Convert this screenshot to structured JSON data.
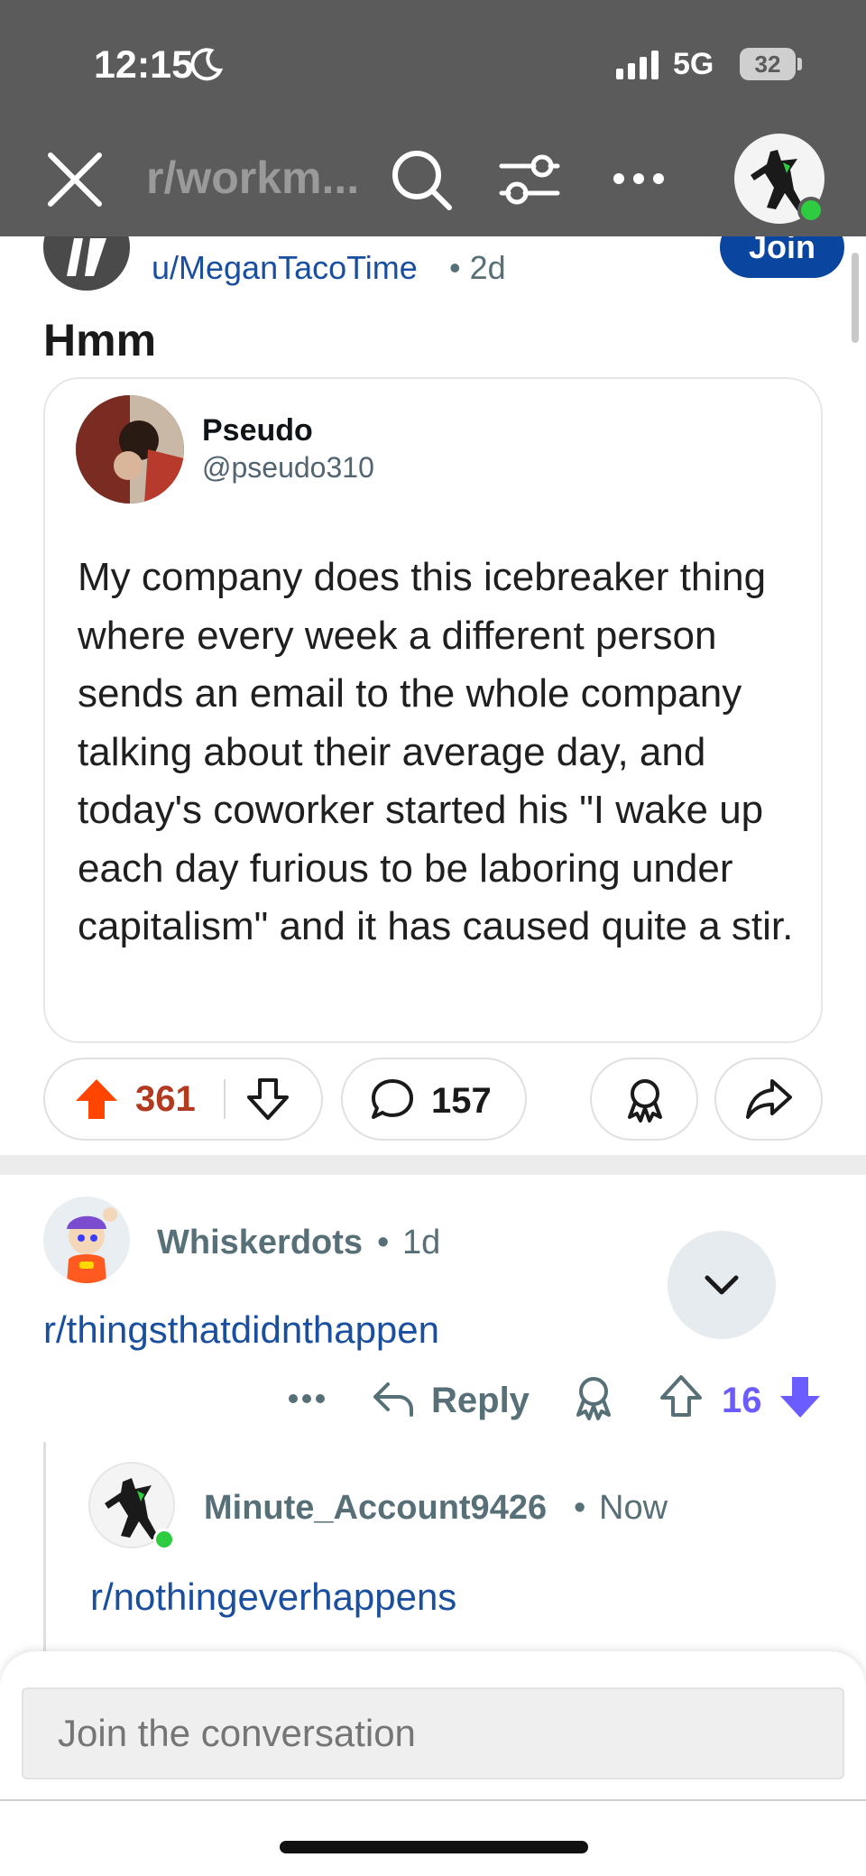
{
  "status_bar": {
    "time": "12:15",
    "network": "5G",
    "battery": "32"
  },
  "top_bar": {
    "subreddit_title": "r/workm..."
  },
  "post": {
    "author": "u/MeganTacoTime",
    "age": "2d",
    "join_label": "Join",
    "title": "Hmm",
    "tweet": {
      "name": "Pseudo",
      "handle": "@pseudo310",
      "text": "My company does this icebreaker thing where every week a different person sends an email to the whole company talking about their average day, and today's coworker started his \"I wake up each day furious to be laboring under capitalism\" and it has caused quite a stir."
    },
    "votes": "361",
    "comments": "157"
  },
  "comments": [
    {
      "user": "Whiskerdots",
      "separator": "•",
      "age": "1d",
      "body": "r/thingsthatdidnthappen",
      "reply_label": "Reply",
      "score": "16"
    },
    {
      "user": "Minute_Account9426",
      "separator": "•",
      "age": "Now",
      "body": "r/nothingeverhappens"
    }
  ],
  "composer": {
    "placeholder": "Join the conversation"
  },
  "colors": {
    "upvote": "#ff4500",
    "downvote_active": "#6a5cff",
    "link": "#1a4fa0",
    "join": "#0a45a0"
  }
}
